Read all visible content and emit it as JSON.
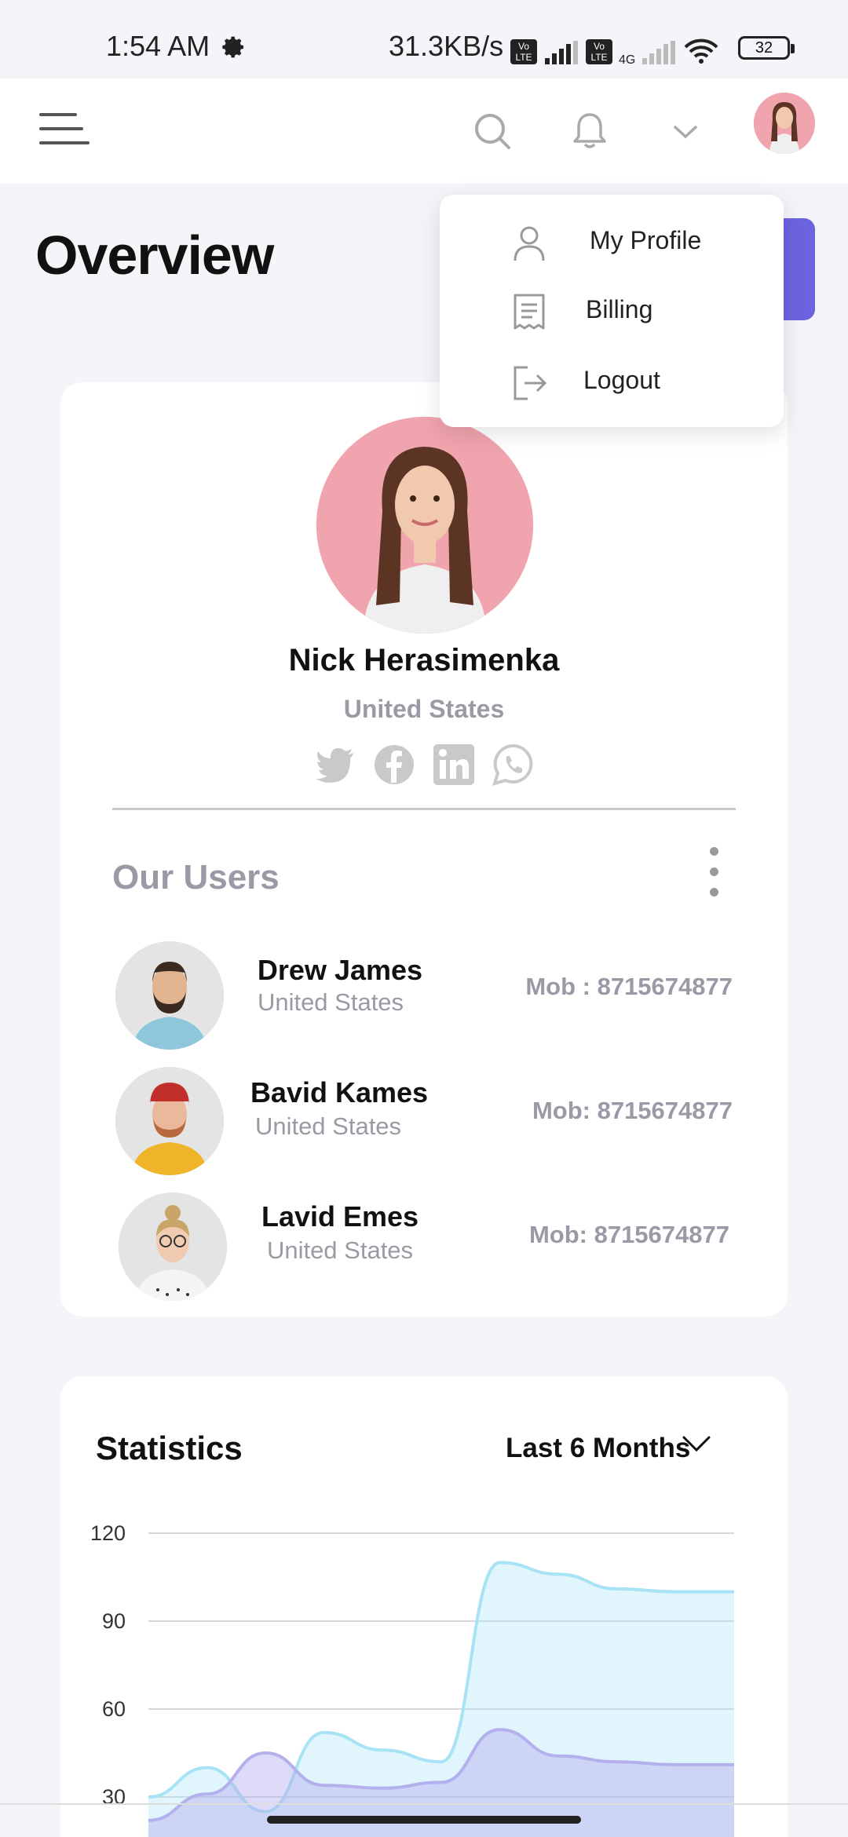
{
  "status_bar": {
    "time": "1:54 AM",
    "net_speed": "31.3KB/s",
    "net_type": "4G",
    "lte_label": "Vo LTE",
    "battery": "32"
  },
  "header": {
    "icons": [
      "menu-icon",
      "search-icon",
      "bell-icon",
      "chevron-down-icon",
      "avatar"
    ]
  },
  "page": {
    "title": "Overview",
    "accent_color": "#6c63e0"
  },
  "dropdown": {
    "items": [
      {
        "label": "My Profile",
        "icon": "user-icon"
      },
      {
        "label": "Billing",
        "icon": "receipt-icon"
      },
      {
        "label": "Logout",
        "icon": "logout-icon"
      }
    ]
  },
  "profile": {
    "name": "Nick Herasimenka",
    "country": "United States",
    "socials": [
      "twitter-icon",
      "facebook-icon",
      "linkedin-icon",
      "whatsapp-icon"
    ]
  },
  "users": {
    "title": "Our Users",
    "list": [
      {
        "name": "Drew James",
        "country": "United States",
        "mob": "Mob : 8715674877"
      },
      {
        "name": "Bavid Kames",
        "country": "United States",
        "mob": "Mob: 8715674877"
      },
      {
        "name": "Lavid Emes",
        "country": "United States",
        "mob": "Mob: 8715674877"
      }
    ]
  },
  "statistics": {
    "title": "Statistics",
    "range": "Last 6 Months"
  },
  "chart_data": {
    "type": "area",
    "title": "Statistics",
    "xlabel": "",
    "ylabel": "",
    "yticks": [
      "120",
      "90",
      "60",
      "30"
    ],
    "ylim": [
      20,
      120
    ],
    "x": [
      0,
      1,
      2,
      3,
      4,
      5,
      6,
      7,
      8,
      9,
      10
    ],
    "series": [
      {
        "values": [
          30,
          40,
          25,
          52,
          46,
          42,
          110,
          106,
          101,
          100,
          100
        ],
        "color": "#a8e2f5"
      },
      {
        "values": [
          22,
          31,
          45,
          34,
          33,
          35,
          53,
          44,
          42,
          41,
          41
        ],
        "color": "#b4b0ee"
      }
    ],
    "grid": true
  }
}
